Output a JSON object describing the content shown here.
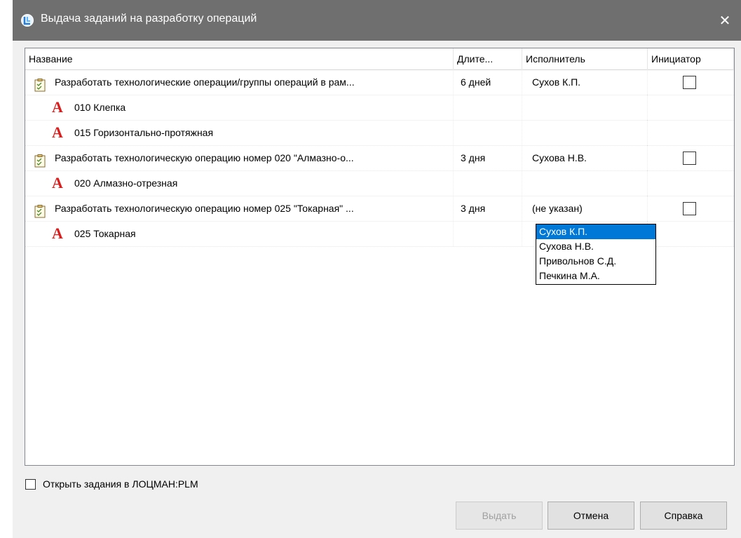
{
  "window": {
    "title": "Выдача заданий на разработку операций",
    "close_glyph": "✕",
    "icon": "app-logo-icon"
  },
  "columns": {
    "name": "Название",
    "duration": "Длите...",
    "executor": "Исполнитель",
    "initiator": "Инициатор"
  },
  "rows": [
    {
      "type": "task",
      "name": "Разработать технологические операции/группы операций в рам...",
      "duration": "6 дней",
      "executor": "Сухов К.П.",
      "initiator": false
    },
    {
      "type": "operation",
      "name": "010 Клепка"
    },
    {
      "type": "operation",
      "name": "015 Горизонтально-протяжная"
    },
    {
      "type": "task",
      "name": "Разработать технологическую операцию номер 020 \"Алмазно-о...",
      "duration": "3 дня",
      "executor": "Сухова Н.В.",
      "initiator": false
    },
    {
      "type": "operation",
      "name": "020 Алмазно-отрезная"
    },
    {
      "type": "task",
      "name": "Разработать технологическую операцию номер 025 \"Токарная\" ...",
      "duration": "3 дня",
      "executor": "(не указан)",
      "initiator": false
    },
    {
      "type": "operation",
      "name": "025 Токарная"
    }
  ],
  "op_icon_glyph": "A",
  "executor_dropdown": {
    "options": [
      "Сухов К.П.",
      "Сухова Н.В.",
      "Привольнов С.Д.",
      "Печкина М.А."
    ],
    "selected_index": 0
  },
  "open_in_plm": {
    "label": "Открыть задания в ЛОЦМАН:PLM",
    "checked": false
  },
  "buttons": {
    "issue": "Выдать",
    "cancel": "Отмена",
    "help": "Справка"
  },
  "colors": {
    "titlebar": "#6f6f6f",
    "selection": "#0078d7",
    "op_icon": "#d81f1f"
  }
}
